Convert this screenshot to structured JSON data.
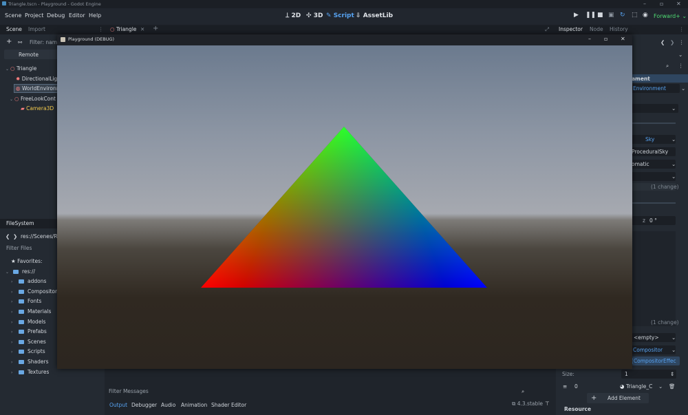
{
  "window": {
    "title": "Triangle.tscn - Playground - Godot Engine"
  },
  "menu": [
    "Scene",
    "Project",
    "Debug",
    "Editor",
    "Help"
  ],
  "workspaces": {
    "w2d": "2D",
    "w3d": "3D",
    "script": "Script",
    "assetlib": "AssetLib"
  },
  "renderer": "Forward+",
  "left_dock": {
    "tabs": [
      "Scene",
      "Import"
    ],
    "filter_placeholder": "Filter: name",
    "remote": "Remote",
    "tree": [
      "Triangle",
      "DirectionalLig",
      "WorldEnvironm",
      "FreeLookCont",
      "Camera3D"
    ]
  },
  "filesystem": {
    "title": "FileSystem",
    "path": "res://Scenes/Ra",
    "filter": "Filter Files",
    "favorites": "Favorites:",
    "root": "res://",
    "folders": [
      "addons",
      "CompositorEf",
      "Fonts",
      "Materials",
      "Models",
      "Prefabs",
      "Scenes",
      "Scripts",
      "Shaders",
      "Textures"
    ]
  },
  "scene_tab": "Triangle",
  "debug_window": {
    "title": "Playground (DEBUG)"
  },
  "inspector": {
    "tabs": [
      "Inspector",
      "Node",
      "History"
    ],
    "section": "ament",
    "env_resource": "Environment",
    "sky_label": "Sky",
    "procedural": "ProceduralSky",
    "auto": "omatic",
    "changes_1": "(1 change)",
    "angle_axis": "z",
    "angle_value": "0 °",
    "changes_2": "(1 change)",
    "empty": "<empty>",
    "compositor": "Compositor",
    "compositor_effect": "[CompositorEffec",
    "size_label": "Size:",
    "size_value": "1",
    "elem_index": "0",
    "elem_value": "Triangle_C",
    "add_element": "Add Element",
    "resource": "Resource"
  },
  "bottom": {
    "filter_messages": "Filter Messages",
    "tabs": [
      "Output",
      "Debugger",
      "Audio",
      "Animation",
      "Shader Editor"
    ],
    "version": "4.3.stable"
  }
}
